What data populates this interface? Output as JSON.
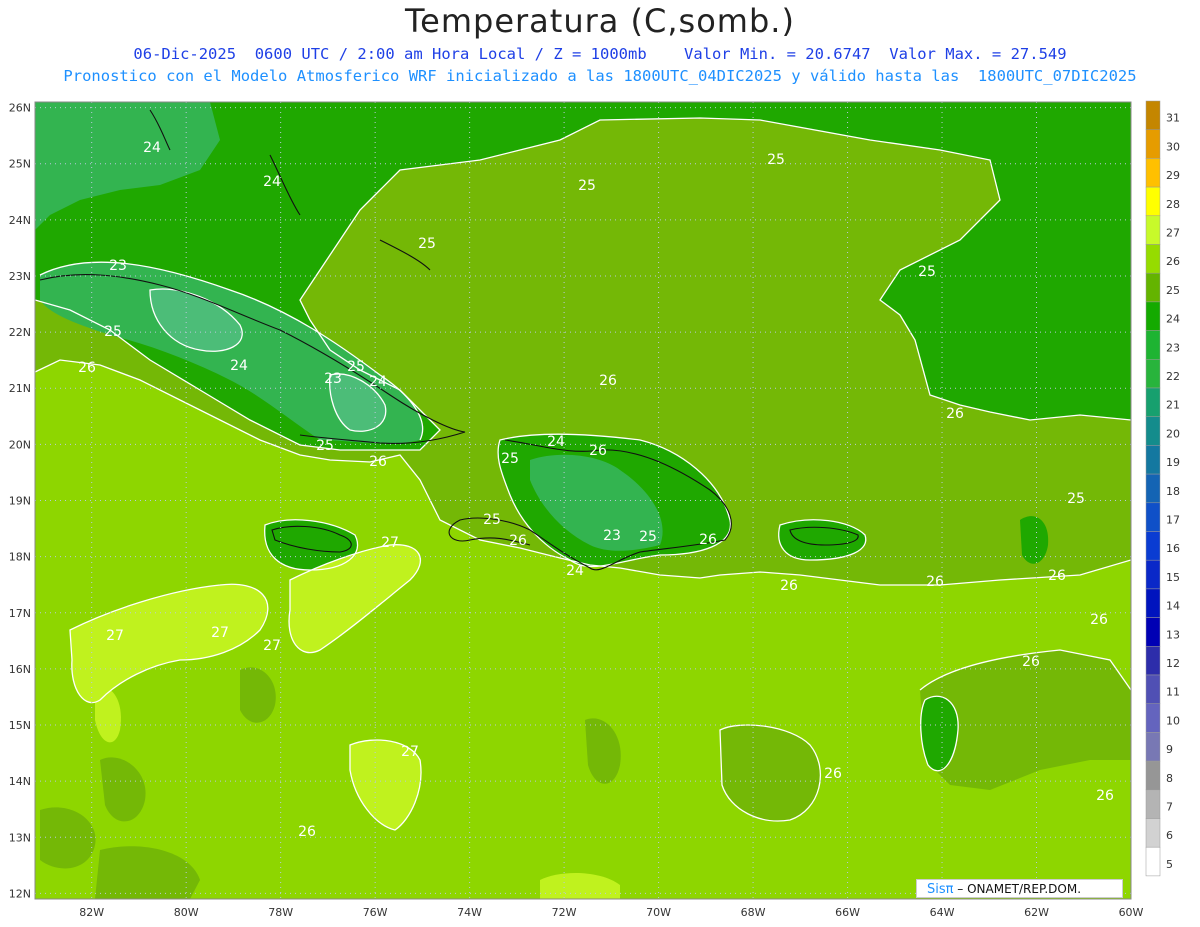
{
  "header": {
    "title": "Temperatura (C,somb.)",
    "line1": "06-Dic-2025  0600 UTC / 2:00 am Hora Local / Z = 1000mb    Valor Min. = 20.6747  Valor Max. = 27.549",
    "line2": "Pronostico con el Modelo Atmosferico WRF inicializado a las 1800UTC_04DIC2025 y válido hasta las  1800UTC_07DIC2025"
  },
  "map": {
    "lon_range": [
      -83.2,
      -60
    ],
    "lat_range": [
      11.9,
      26.1
    ],
    "lon_ticks": [
      "82W",
      "80W",
      "78W",
      "76W",
      "74W",
      "72W",
      "70W",
      "68W",
      "66W",
      "64W",
      "62W",
      "60W"
    ],
    "lat_ticks": [
      "12N",
      "13N",
      "14N",
      "15N",
      "16N",
      "17N",
      "18N",
      "19N",
      "20N",
      "21N",
      "22N",
      "23N",
      "24N",
      "25N",
      "26N"
    ],
    "grid_style": "dotted",
    "contour_labels": [
      "24",
      "24",
      "23",
      "25",
      "26",
      "24",
      "23",
      "25",
      "24",
      "25",
      "26",
      "25",
      "25",
      "25",
      "25",
      "26",
      "25",
      "24",
      "26",
      "25",
      "26",
      "24",
      "23",
      "25",
      "26",
      "27",
      "27",
      "27",
      "27",
      "27",
      "26",
      "26",
      "26",
      "26",
      "26",
      "25",
      "26",
      "26",
      "26",
      "26"
    ]
  },
  "colorbar": {
    "levels": [
      "31",
      "30",
      "29",
      "28",
      "27",
      "26",
      "25",
      "24",
      "23",
      "22",
      "21",
      "20",
      "19",
      "18",
      "17",
      "16",
      "15",
      "14",
      "13",
      "12",
      "11",
      "10",
      "9",
      "8",
      "7",
      "6",
      "5"
    ],
    "colors": [
      "#c48600",
      "#e69c00",
      "#ffc000",
      "#ffff00",
      "#c8fa2a",
      "#96dc00",
      "#64b400",
      "#14aa00",
      "#1eb432",
      "#28b43c",
      "#17a06e",
      "#148c8c",
      "#1478a0",
      "#1464b4",
      "#0f50c8",
      "#0a3cd2",
      "#0a28c8",
      "#0014be",
      "#0000b4",
      "#2d2daa",
      "#5050b4",
      "#6464be",
      "#7878b4",
      "#969696",
      "#b4b4b4",
      "#d2d2d2",
      "#ffffff"
    ]
  },
  "credit": {
    "logo": "Sisπ",
    "text": "– ONAMET/REP.DOM."
  }
}
